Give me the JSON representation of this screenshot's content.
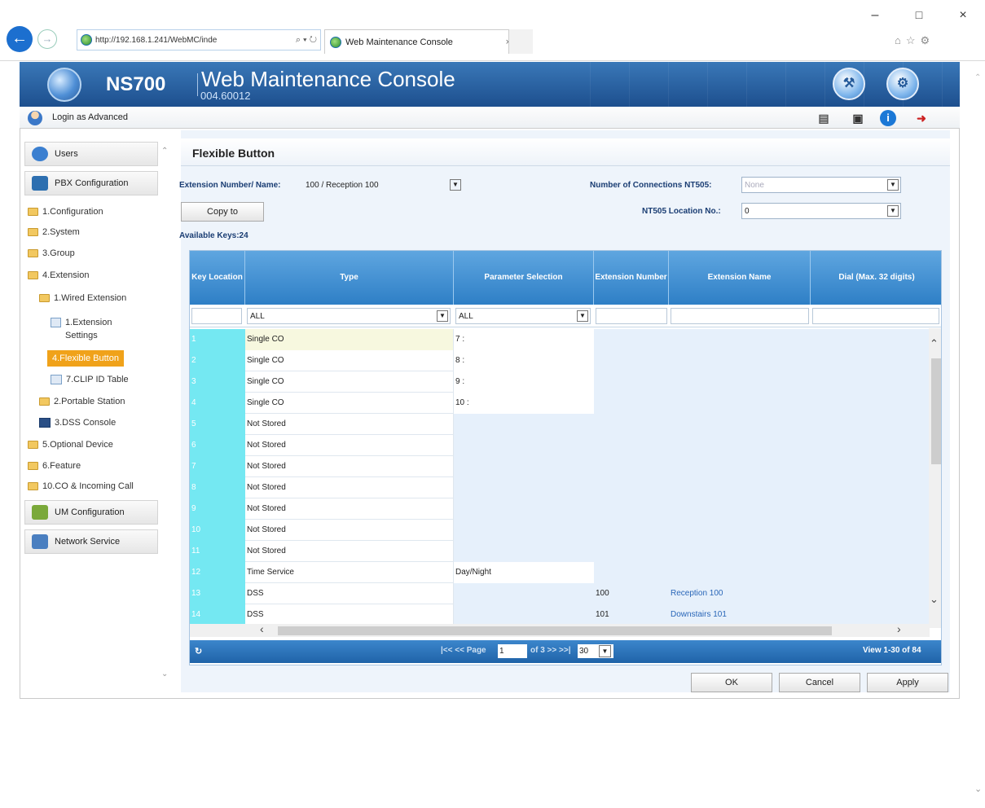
{
  "browser": {
    "url": "http://192.168.1.241/WebMC/inde",
    "address_controls": "⌕ ▾ ↻",
    "tab_title": "Web Maintenance Console",
    "window_controls": {
      "minimize": "–",
      "maximize": "□",
      "close": "×"
    },
    "toolbar_icons": "⌂☆⚙"
  },
  "header": {
    "product": "NS700",
    "title": "Web Maintenance Console",
    "version": "004.60012"
  },
  "login": {
    "label": "Login as Advanced"
  },
  "sidebar": {
    "categories": [
      {
        "label": "Users",
        "color": "#3b7fd0"
      },
      {
        "label": "PBX Configuration",
        "color": "#2d6fb0"
      },
      {
        "label": "UM Configuration",
        "color": "#7aa93a"
      },
      {
        "label": "Network Service",
        "color": "#4a7fc0"
      }
    ],
    "tree": [
      {
        "label": "1.Configuration"
      },
      {
        "label": "2.System"
      },
      {
        "label": "3.Group"
      },
      {
        "label": "4.Extension"
      },
      {
        "label": "1.Wired Extension"
      },
      {
        "label": "1.Extension Settings"
      },
      {
        "label": "4.Flexible Button"
      },
      {
        "label": "7.CLIP ID Table"
      },
      {
        "label": "2.Portable Station"
      },
      {
        "label": "3.DSS Console"
      },
      {
        "label": "5.Optional Device"
      },
      {
        "label": "6.Feature"
      },
      {
        "label": "10.CO & Incoming Call"
      }
    ]
  },
  "panel": {
    "title": "Flexible Button",
    "ext_label": "Extension Number/ Name:",
    "ext_value": "100 / Reception 100",
    "connections_label": "Number of Connections NT505:",
    "connections_value": "None",
    "location_label": "NT505 Location No.:",
    "location_value": "0",
    "copy_button": "Copy to",
    "available_keys": "Available Keys:24"
  },
  "grid": {
    "columns": [
      "Key Location",
      "Type",
      "Parameter Selection",
      "Extension Number",
      "Extension Name",
      "Dial (Max. 32 digits)"
    ],
    "filter_type": "ALL",
    "filter_param": "ALL",
    "rows": [
      {
        "key": "1",
        "type": "Single CO",
        "param": "7 :",
        "ext": "",
        "name": ""
      },
      {
        "key": "2",
        "type": "Single CO",
        "param": "8 :",
        "ext": "",
        "name": ""
      },
      {
        "key": "3",
        "type": "Single CO",
        "param": "9 :",
        "ext": "",
        "name": ""
      },
      {
        "key": "4",
        "type": "Single CO",
        "param": "10 :",
        "ext": "",
        "name": ""
      },
      {
        "key": "5",
        "type": "Not Stored",
        "param": "",
        "ext": "",
        "name": ""
      },
      {
        "key": "6",
        "type": "Not Stored",
        "param": "",
        "ext": "",
        "name": ""
      },
      {
        "key": "7",
        "type": "Not Stored",
        "param": "",
        "ext": "",
        "name": ""
      },
      {
        "key": "8",
        "type": "Not Stored",
        "param": "",
        "ext": "",
        "name": ""
      },
      {
        "key": "9",
        "type": "Not Stored",
        "param": "",
        "ext": "",
        "name": ""
      },
      {
        "key": "10",
        "type": "Not Stored",
        "param": "",
        "ext": "",
        "name": ""
      },
      {
        "key": "11",
        "type": "Not Stored",
        "param": "",
        "ext": "",
        "name": ""
      },
      {
        "key": "12",
        "type": "Time Service",
        "param": "Day/Night",
        "ext": "",
        "name": ""
      },
      {
        "key": "13",
        "type": "DSS",
        "param": "",
        "ext": "100",
        "name": "Reception 100"
      },
      {
        "key": "14",
        "type": "DSS",
        "param": "",
        "ext": "101",
        "name": "Downstairs 101"
      }
    ],
    "pager": {
      "nav": "|<< << Page",
      "page": "1",
      "of": "of 3 >> >>|",
      "page_size": "30",
      "view": "View 1-30 of 84"
    }
  },
  "actions": {
    "ok": "OK",
    "cancel": "Cancel",
    "apply": "Apply"
  }
}
